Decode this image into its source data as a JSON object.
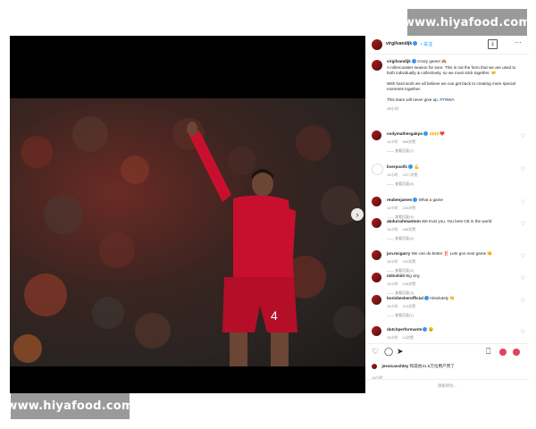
{
  "watermark": {
    "text": "www.hiyafood.com"
  },
  "post": {
    "username": "virgilvandijk",
    "follow_label": "• 关注",
    "caption_lines": [
      "Crazy game! 🙈",
      "A rollercoaster season for sure. This is not the form that we are used to both individually & collectively, so we must stick together. 🤝",
      "With hard work we all believe we can get back to creating more special moments together.",
      "This team will never give up."
    ],
    "hashtag": "#YNWA",
    "caption_time": "15小时"
  },
  "comments": [
    {
      "user": "codymathesgakpo",
      "text": "🙌🙌❤️",
      "time": "14小时",
      "likes": "668次赞",
      "replies": "—— 查看回复(7)"
    },
    {
      "user": "liverpoolfc",
      "text": "💪",
      "time": "15小时",
      "likes": "1377次赞",
      "replies": "—— 查看回复(8)"
    },
    {
      "user": "reubenjames",
      "text": "What a game",
      "time": "14小时",
      "likes": "233次赞",
      "replies": "—— 查看回复(5)"
    },
    {
      "user": "abdurrahmantom",
      "text": "We trust you. You best CB in the world",
      "time": "15小时",
      "likes": "446次赞",
      "replies": "—— 查看回复(4)"
    },
    {
      "user": "jon.mcgarry",
      "text": "We can do better ‼️ Lets goo next game 👊",
      "time": "15小时",
      "likes": "153次赞",
      "replies": "—— 查看回复(2)"
    },
    {
      "user": "miloshii0",
      "text": "Big virg",
      "time": "15小时",
      "likes": "106次赞",
      "replies": "—— 查看回复(3)"
    },
    {
      "user": "borisbeckerofficial",
      "text": "Absolutely 👏",
      "time": "15小时",
      "likes": "213次赞",
      "replies": "—— 查看回复(1)"
    },
    {
      "user": "dutchperformante",
      "text": "😉",
      "time": "15小时",
      "likes": "14次赞",
      "replies": ""
    }
  ],
  "likes": {
    "first_user": "jessicasohley",
    "text": "和其他41.5万位用户赞了",
    "time": "15小时"
  },
  "add_comment": {
    "placeholder": "添加评论..."
  },
  "icons": [
    "like-icon",
    "comment-icon",
    "share-icon",
    "save-icon",
    "emoji-icon",
    "more-icon",
    "download-icon"
  ],
  "colors": {
    "accent": "#0095f6",
    "jersey": "#c8102e",
    "heart": "#e4405f"
  }
}
